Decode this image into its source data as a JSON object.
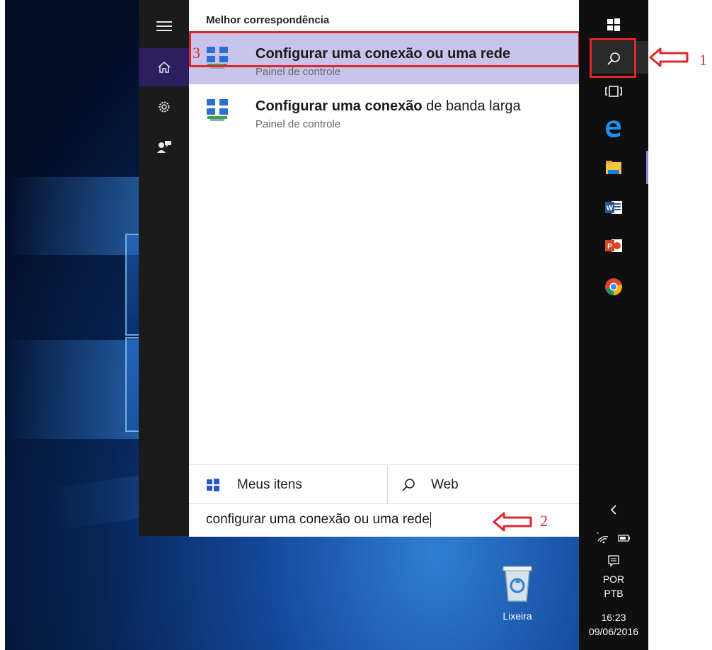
{
  "search_panel": {
    "section_header": "Melhor correspondência",
    "results": [
      {
        "title_bold": "Configurar uma conexão ou uma rede",
        "title_rest": "",
        "subtitle": "Painel de controle",
        "selected": true
      },
      {
        "title_bold": "Configurar uma conexão",
        "title_rest": " de banda larga",
        "subtitle": "Painel de controle",
        "selected": false
      }
    ],
    "tabs": [
      {
        "label": "Meus itens",
        "icon": "windows-icon"
      },
      {
        "label": "Web",
        "icon": "search-icon"
      }
    ],
    "search_query": "configurar uma conexão ou uma rede"
  },
  "sidebar": {
    "items": [
      {
        "icon": "hamburger-menu-icon"
      },
      {
        "icon": "home-icon",
        "active": true
      },
      {
        "icon": "gear-icon"
      },
      {
        "icon": "feedback-icon"
      }
    ]
  },
  "taskbar": {
    "language_line1": "POR",
    "language_line2": "PTB",
    "time": "16:23",
    "date": "09/06/2016"
  },
  "desktop": {
    "recycle_bin_label": "Lixeira"
  },
  "annotations": {
    "label_1": "1",
    "label_2": "2",
    "label_3": "3",
    "color": "#e0262c"
  },
  "colors": {
    "accent": "#c8c3ea",
    "sidebar_active": "#2b1f5f"
  }
}
